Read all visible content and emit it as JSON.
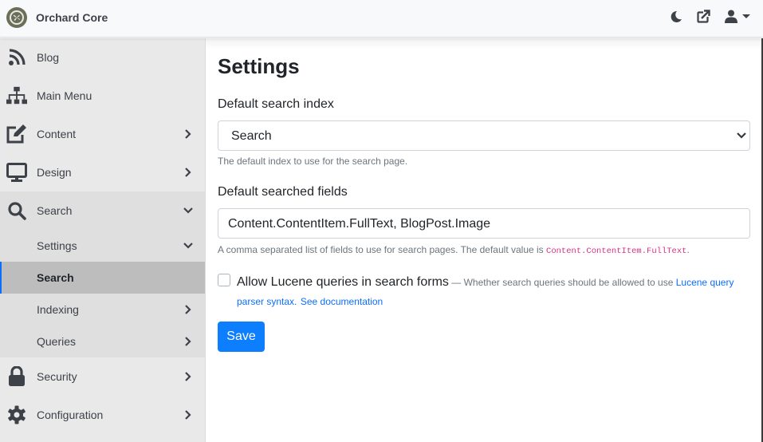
{
  "header": {
    "brand": "Orchard Core",
    "icons": [
      "moon-icon",
      "external-link-icon",
      "user-icon",
      "caret-down-icon"
    ]
  },
  "sidebar": {
    "items": [
      {
        "label": "Blog",
        "icon": "rss-icon",
        "chevron": false
      },
      {
        "label": "Main Menu",
        "icon": "sitemap-icon",
        "chevron": false
      },
      {
        "label": "Content",
        "icon": "edit-icon",
        "chevron": "right"
      },
      {
        "label": "Design",
        "icon": "desktop-icon",
        "chevron": "right"
      },
      {
        "label": "Search",
        "icon": "search-icon",
        "chevron": "down"
      },
      {
        "label": "Security",
        "icon": "lock-icon",
        "chevron": "right"
      },
      {
        "label": "Configuration",
        "icon": "cog-icon",
        "chevron": "right"
      }
    ],
    "search_children": [
      {
        "label": "Settings",
        "chevron": "down"
      },
      {
        "label": "Search",
        "active": true
      },
      {
        "label": "Indexing",
        "chevron": "right"
      },
      {
        "label": "Queries",
        "chevron": "right"
      }
    ]
  },
  "main": {
    "title": "Settings",
    "index_label": "Default search index",
    "index_value": "Search",
    "index_help": "The default index to use for the search page.",
    "fields_label": "Default searched fields",
    "fields_value": "Content.ContentItem.FullText, BlogPost.Image",
    "fields_help": "A comma separated list of fields to use for search pages. The default value is ",
    "fields_help_code": "Content.ContentItem.FullText",
    "fields_help_end": ".",
    "lucene_label": "Allow Lucene queries in search forms",
    "lucene_checked": false,
    "lucene_hint": " — Whether search queries should be allowed to use ",
    "lucene_link": "Lucene query parser syntax.",
    "doc_link": "See documentation",
    "save_label": "Save"
  },
  "colors": {
    "primary": "#0d7efd",
    "sidebar_bg": "#e9e9e9",
    "active_bg": "#bdbdbd",
    "code": "#d63384"
  }
}
